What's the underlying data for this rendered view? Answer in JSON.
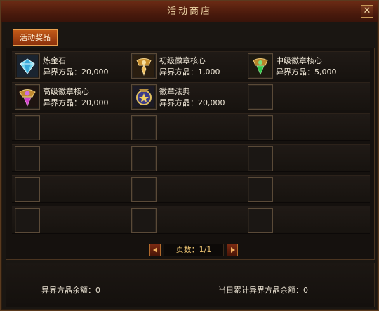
{
  "window": {
    "title": "活动商店",
    "close_label": "✕"
  },
  "tab": {
    "label": "活动奖品"
  },
  "items": [
    {
      "name": "炼金石",
      "price": "异界方晶：20,000",
      "icon": "diamond-icon"
    },
    {
      "name": "初级徽章核心",
      "price": "异界方晶：1,000",
      "icon": "emblem-core-gold-icon"
    },
    {
      "name": "中级徽章核心",
      "price": "异界方晶：5,000",
      "icon": "emblem-core-green-icon"
    },
    {
      "name": "高级徽章核心",
      "price": "异界方晶：20,000",
      "icon": "emblem-core-purple-icon"
    },
    {
      "name": "徽章法典",
      "price": "异界方晶：20,000",
      "icon": "emblem-codex-icon"
    }
  ],
  "pager": {
    "label": "页数：1/1"
  },
  "footer": {
    "balance": "异界方晶余额：0",
    "daily_total": "当日累计异界方晶余额：0"
  },
  "colors": {
    "accent": "#c25a18",
    "title_bg": "#4a1a0c",
    "text": "#e8e0d0"
  }
}
